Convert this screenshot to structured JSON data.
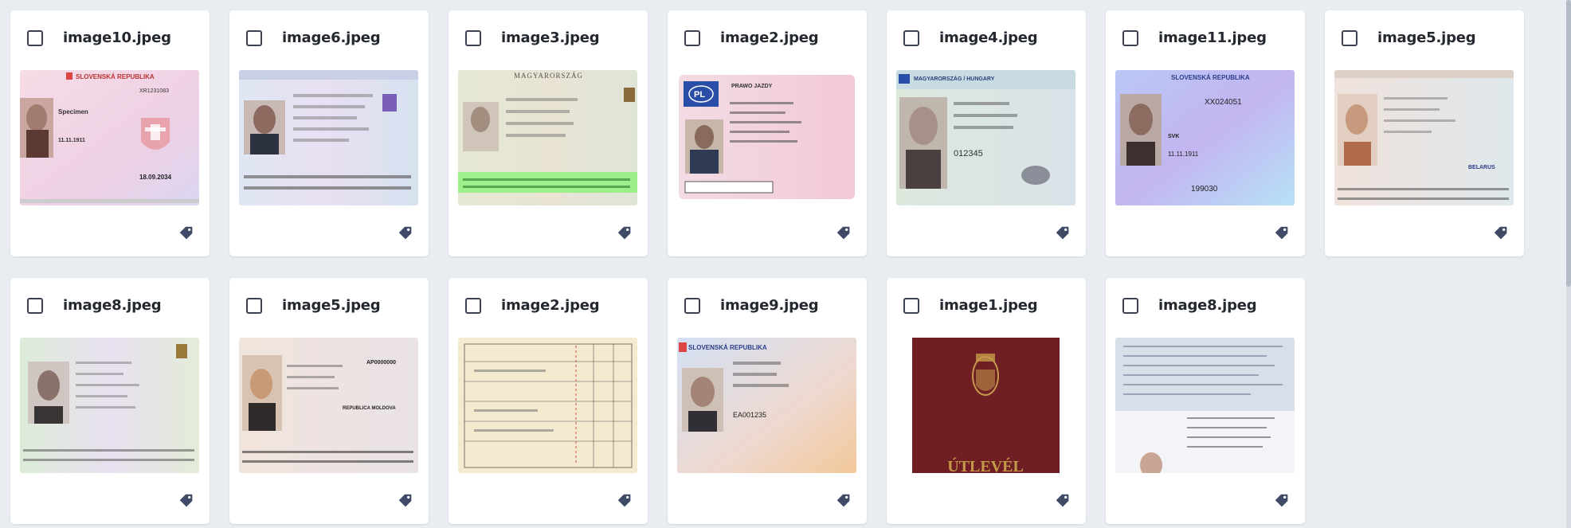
{
  "gallery": {
    "items": [
      {
        "filename": "image10.jpeg",
        "thumb_icon": "slovak-id-card-thumbnail",
        "tag_icon": "tag-icon"
      },
      {
        "filename": "image6.jpeg",
        "thumb_icon": "slovak-residence-card-thumbnail",
        "tag_icon": "tag-icon"
      },
      {
        "filename": "image3.jpeg",
        "thumb_icon": "hungarian-id-card-thumbnail",
        "tag_icon": "tag-icon"
      },
      {
        "filename": "image2.jpeg",
        "thumb_icon": "polish-driving-licence-thumbnail",
        "tag_icon": "tag-icon"
      },
      {
        "filename": "image4.jpeg",
        "thumb_icon": "hungarian-identity-card-thumbnail",
        "tag_icon": "tag-icon"
      },
      {
        "filename": "image11.jpeg",
        "thumb_icon": "slovak-republic-id-thumbnail",
        "tag_icon": "tag-icon"
      },
      {
        "filename": "image5.jpeg",
        "thumb_icon": "belarus-id-card-thumbnail",
        "tag_icon": "tag-icon"
      },
      {
        "filename": "image8.jpeg",
        "thumb_icon": "id-card-specimen-thumbnail",
        "tag_icon": "tag-icon"
      },
      {
        "filename": "image5.jpeg",
        "thumb_icon": "moldova-id-card-thumbnail",
        "tag_icon": "tag-icon"
      },
      {
        "filename": "image2.jpeg",
        "thumb_icon": "scanned-form-thumbnail",
        "tag_icon": "tag-icon"
      },
      {
        "filename": "image9.jpeg",
        "thumb_icon": "slovak-driving-licence-thumbnail",
        "tag_icon": "tag-icon"
      },
      {
        "filename": "image1.jpeg",
        "thumb_icon": "hungarian-passport-cover-thumbnail",
        "tag_icon": "tag-icon"
      },
      {
        "filename": "image8.jpeg",
        "thumb_icon": "passport-page-scan-thumbnail",
        "tag_icon": "tag-icon"
      }
    ]
  },
  "thumb_text": {
    "slovak_republika": "SLOVENSKÁ REPUBLIKA",
    "magyarorszag": "MAGYARORSZÁG",
    "magyarorszag_hungary": "MAGYARORSZÁG / HUNGARY",
    "pl": "PL",
    "prawo_jazdy": "PRAWO JAZDY",
    "specimen": "Specimen",
    "number_1": "XR1231083",
    "number_2": "XX024051",
    "number_3": "199030",
    "number_4": "012345",
    "date_1": "18.09.2034",
    "date_2": "11.11.1911",
    "belarus": "BELARUS",
    "republica_moldova": "REPUBLICA MOLDOVA",
    "moldova_number": "AP0000000",
    "slovak_dl_number": "EA001235",
    "utlevel": "ÚTLEVÉL",
    "svk": "SVK"
  },
  "colors": {
    "tag": "#3e4a66",
    "checkbox_border": "#3b4150",
    "passport_red": "#6f1f24",
    "page_bg": "#e9ecf1"
  }
}
